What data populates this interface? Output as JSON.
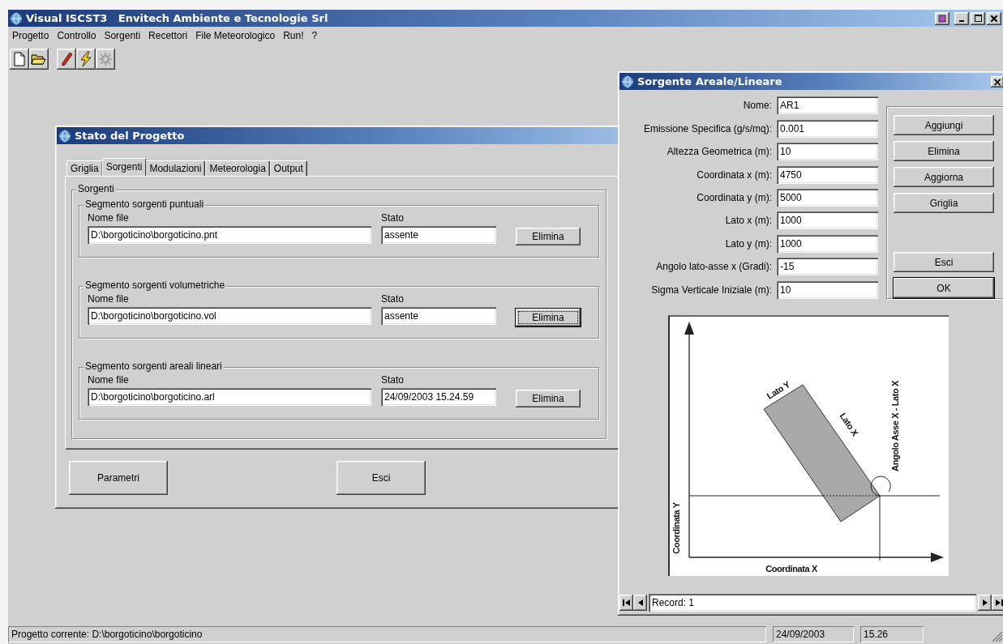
{
  "window": {
    "title": "Visual ISCST3   Envitech Ambiente e Tecnologie Srl",
    "controls": [
      {
        "kind": "app"
      },
      {
        "kind": "minimize"
      },
      {
        "kind": "maximize"
      },
      {
        "kind": "close"
      }
    ]
  },
  "menu": [
    "Progetto",
    "Controllo",
    "Sorgenti",
    "Recettori",
    "File Meteorologico",
    "Run!",
    "?"
  ],
  "toolbar": [
    [
      {
        "kind": "new",
        "disabled": false
      },
      {
        "kind": "open",
        "disabled": false
      }
    ],
    [
      {
        "kind": "pencil",
        "disabled": false
      },
      {
        "kind": "lightning",
        "disabled": false
      },
      {
        "kind": "gear",
        "disabled": true
      }
    ]
  ],
  "project_dialog": {
    "title": "Stato del Progetto",
    "tabs": [
      {
        "label": "Griglia",
        "selected": false
      },
      {
        "label": "Sorgenti",
        "selected": true
      },
      {
        "label": "Modulazioni",
        "selected": false
      },
      {
        "label": "Meteorologia",
        "selected": false
      },
      {
        "label": "Output",
        "selected": false
      }
    ],
    "group_title": "Sorgenti",
    "segments": [
      {
        "title": "Segmento sorgenti puntuali",
        "file_label": "Nome file",
        "file": "D:\\borgoticino\\borgoticino.pnt",
        "state_label": "Stato",
        "state": "assente",
        "button": "Elimina",
        "focused": false
      },
      {
        "title": "Segmento sorgenti volumetriche",
        "file_label": "Nome file",
        "file": "D:\\borgoticino\\borgoticino.vol",
        "state_label": "Stato",
        "state": "assente",
        "button": "Elimina",
        "focused": true
      },
      {
        "title": "Segmento sorgenti areali lineari",
        "file_label": "Nome file",
        "file": "D:\\borgoticino\\borgoticino.arl",
        "state_label": "Stato",
        "state": "24/09/2003 15.24.59",
        "button": "Elimina",
        "focused": false
      }
    ],
    "buttons": [
      "Parametri",
      "Esci"
    ]
  },
  "source_dialog": {
    "title": "Sorgente Areale/Lineare",
    "close": "×",
    "fields": [
      {
        "label": "Nome:",
        "value": "AR1"
      },
      {
        "label": "Emissione Specifica (g/s/mq):",
        "value": "0.001"
      },
      {
        "label": "Altezza Geometrica (m):",
        "value": "10"
      },
      {
        "label": "Coordinata x (m):",
        "value": "4750"
      },
      {
        "label": "Coordinata y (m):",
        "value": "5000"
      },
      {
        "label": "Lato x (m):",
        "value": "1000"
      },
      {
        "label": "Lato y (m):",
        "value": "1000"
      },
      {
        "label": "Angolo lato-asse x (Gradi):",
        "value": "-15"
      },
      {
        "label": "Sigma Verticale Iniziale (m):",
        "value": "10"
      }
    ],
    "buttons": [
      [
        {
          "label": "Aggiungi",
          "default": false
        },
        {
          "label": "Elimina",
          "default": false
        },
        {
          "label": "Aggiorna",
          "default": false
        },
        {
          "label": "Griglia",
          "default": false
        }
      ],
      [
        {
          "label": "Esci",
          "default": false
        },
        {
          "label": "OK",
          "default": true
        }
      ]
    ],
    "diagram": {
      "side_y_label": "Lato Y",
      "side_x_label": "Lato X",
      "angle_label": "Angolo Asse X - Lato X",
      "y_axis_label": "Coordinata Y",
      "x_axis_label": "Coordinata X"
    },
    "record": "Record: 1"
  },
  "status_bar": {
    "project": "Progetto corrente: D:\\borgoticino\\borgoticino",
    "date": "24/09/2003",
    "time": "15.26"
  }
}
